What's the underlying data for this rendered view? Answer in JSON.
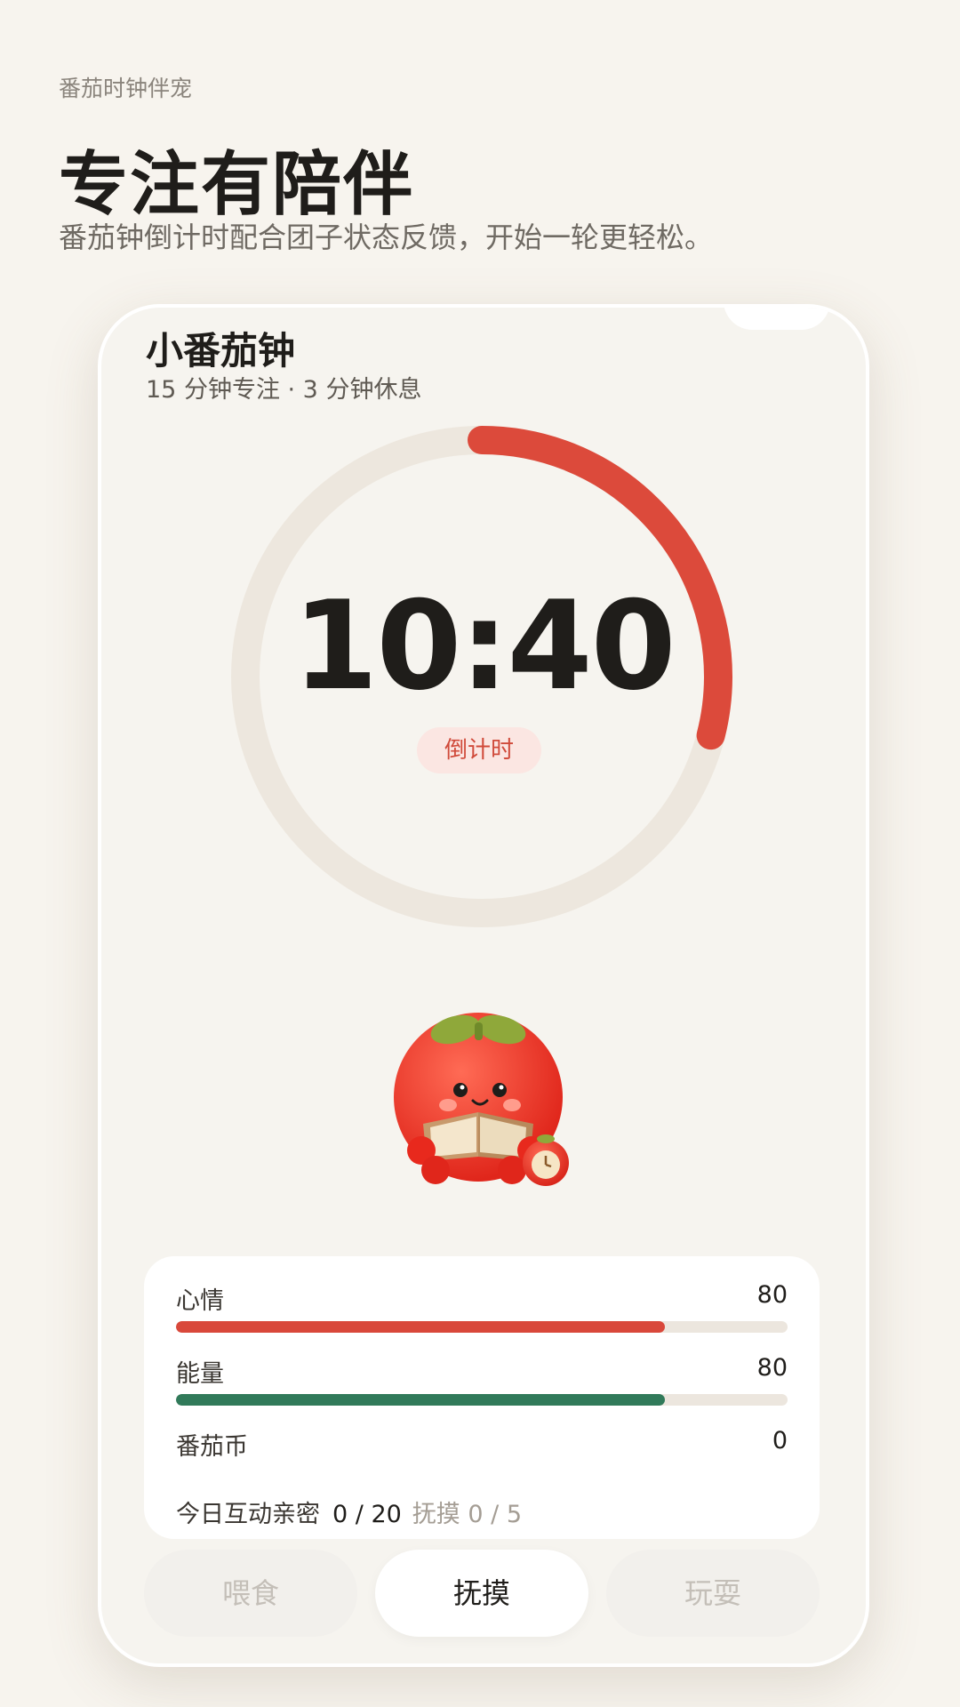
{
  "app": {
    "subtitle": "番茄时钟伴宠"
  },
  "hero": {
    "title": "专注有陪伴",
    "description": "番茄钟倒计时配合团子状态反馈，开始一轮更轻松。"
  },
  "timer": {
    "title": "小番茄钟",
    "subtitle": "15 分钟专注 · 3 分钟休息",
    "time": "10:40",
    "mode": "倒计时",
    "progress": 0.29,
    "colors": {
      "accent": "#dc4a3b",
      "track": "#ede7de"
    }
  },
  "stats": {
    "mood": {
      "label": "心情",
      "value": "80",
      "level": 0.8,
      "color": "#d9483b"
    },
    "energy": {
      "label": "能量",
      "value": "80",
      "level": 0.8,
      "color": "#317a5a"
    },
    "coins": {
      "label": "番茄币",
      "value": "0"
    },
    "interaction": {
      "label": "今日互动亲密",
      "count": "0 / 20",
      "pet_count": "抚摸 0 / 5"
    }
  },
  "actions": {
    "feed": "喂食",
    "pet": "抚摸",
    "play": "玩耍"
  },
  "pet": {
    "icon": "tomato-pet-reading-icon"
  }
}
